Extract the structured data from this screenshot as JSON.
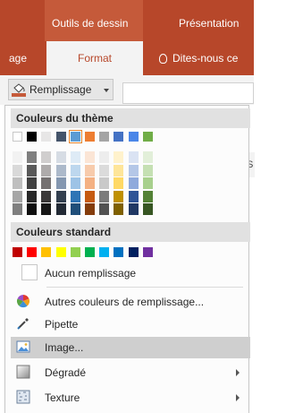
{
  "ribbon": {
    "contextual_group": "Outils de dessin",
    "presentation_tab": "Présentation",
    "partial_tab": "age",
    "format_tab": "Format",
    "tell_me": "Dites-nous ce",
    "fill_button": "Remplissage",
    "side_partial": "S",
    "colors": {
      "ribbon": "#b7472a",
      "contextual": "#c55a3a"
    }
  },
  "menu": {
    "theme_header": "Couleurs du thème",
    "theme_top": [
      "#ffffff",
      "#000000",
      "#e7e6e6",
      "#44546a",
      "#5b9bd5",
      "#ed7d31",
      "#a5a5a5",
      "#4472c4",
      "#4a86e8",
      "#70ad47"
    ],
    "theme_shades": [
      [
        "#f2f2f2",
        "#d9d9d9",
        "#bfbfbf",
        "#a6a6a6",
        "#7f7f7f"
      ],
      [
        "#7f7f7f",
        "#595959",
        "#404040",
        "#262626",
        "#0d0d0d"
      ],
      [
        "#d0cece",
        "#aeabab",
        "#757171",
        "#3a3838",
        "#161616"
      ],
      [
        "#d6dce4",
        "#acb9ca",
        "#8497b0",
        "#323f4f",
        "#222a35"
      ],
      [
        "#deebf6",
        "#bdd7ee",
        "#9dc3e6",
        "#2e75b5",
        "#1f4e79"
      ],
      [
        "#fbe5d5",
        "#f7cbac",
        "#f4b183",
        "#c55a11",
        "#843c0b"
      ],
      [
        "#ededed",
        "#dbdbdb",
        "#c9c9c9",
        "#7b7b7b",
        "#525252"
      ],
      [
        "#fff2cc",
        "#fee599",
        "#ffd965",
        "#bf9000",
        "#7f6000"
      ],
      [
        "#dae3f3",
        "#b4c7e7",
        "#8faadc",
        "#2f5496",
        "#203864"
      ],
      [
        "#e2efd9",
        "#c5e0b3",
        "#a8d08d",
        "#538135",
        "#375623"
      ]
    ],
    "standard_header": "Couleurs standard",
    "standard_colors": [
      "#c00000",
      "#ff0000",
      "#ffc000",
      "#ffff00",
      "#92d050",
      "#00b050",
      "#00b0f0",
      "#0070c0",
      "#002060",
      "#7030a0"
    ],
    "no_fill": "Aucun remplissage",
    "more_colors": "Autres couleurs de remplissage...",
    "eyedropper": "Pipette",
    "picture": "Image...",
    "gradient": "Dégradé",
    "texture": "Texture"
  }
}
